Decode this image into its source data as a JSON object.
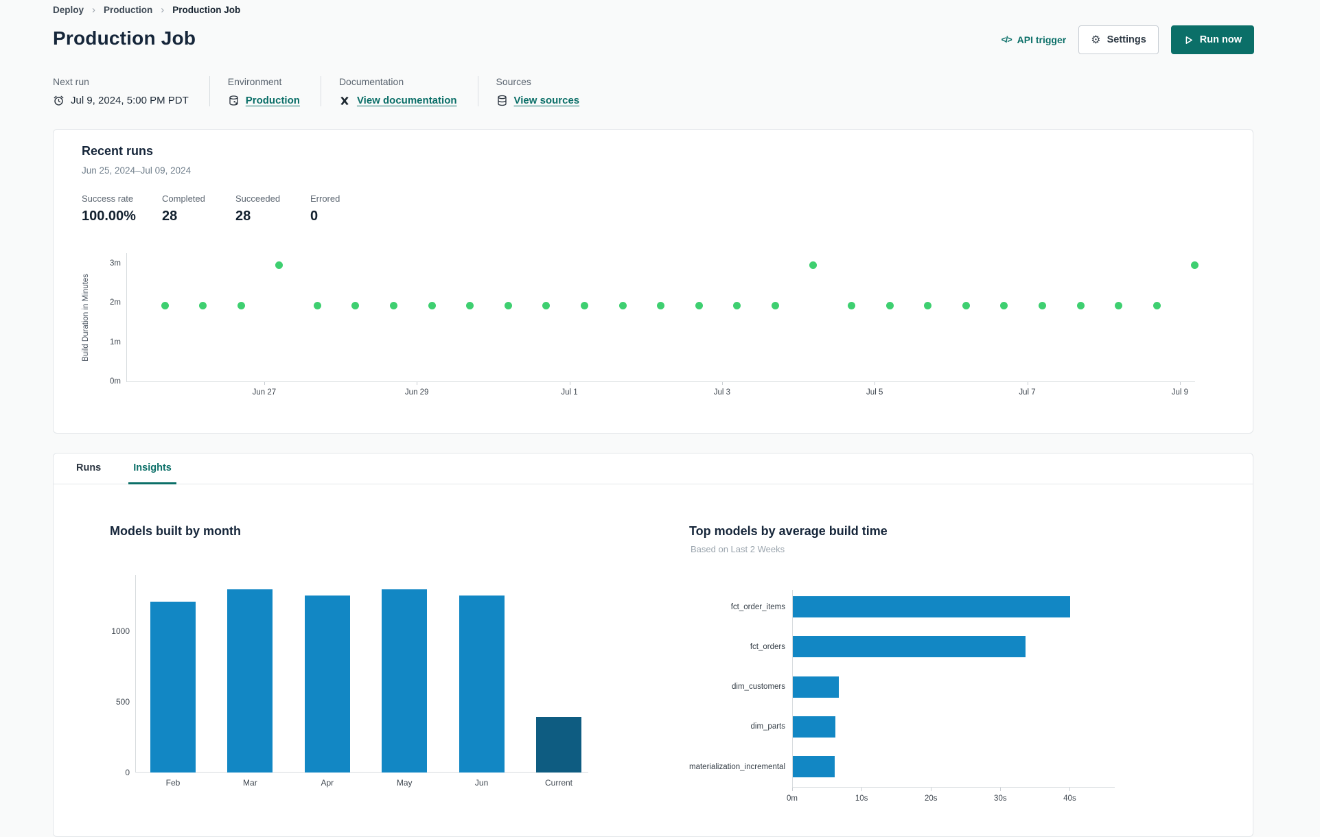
{
  "breadcrumb": {
    "items": [
      "Deploy",
      "Production",
      "Production Job"
    ]
  },
  "header": {
    "title": "Production Job",
    "api_trigger_label": "API trigger",
    "settings_label": "Settings",
    "run_now_label": "Run now"
  },
  "icons": {
    "code_glyph": "</>",
    "gear_glyph": "⚙",
    "chevron_glyph": "›"
  },
  "meta": {
    "next_run": {
      "label": "Next run",
      "value": "Jul 9, 2024, 5:00 PM PDT"
    },
    "environment": {
      "label": "Environment",
      "value": "Production"
    },
    "documentation": {
      "label": "Documentation",
      "value": "View documentation"
    },
    "sources": {
      "label": "Sources",
      "value": "View sources"
    }
  },
  "recent_runs": {
    "title": "Recent runs",
    "date_range": "Jun 25, 2024–Jul 09, 2024",
    "stats": [
      {
        "label": "Success rate",
        "value": "100.00%"
      },
      {
        "label": "Completed",
        "value": "28"
      },
      {
        "label": "Succeeded",
        "value": "28"
      },
      {
        "label": "Errored",
        "value": "0"
      }
    ]
  },
  "tabs": [
    {
      "label": "Runs",
      "active": false
    },
    {
      "label": "Insights",
      "active": true
    }
  ],
  "colors": {
    "teal": "#0b6f68",
    "bar_blue": "#1287c4",
    "bar_dark": "#0e5c81",
    "dot_green": "#3ecf70",
    "card_border": "#e3e6e9",
    "axis": "#d7dbde"
  },
  "chart_data": [
    {
      "id": "build_duration_scatter",
      "type": "scatter",
      "ylabel": "Build Duration in Minutes",
      "ylim": [
        0,
        3.28
      ],
      "yticks": [
        {
          "v": 0,
          "label": "0m"
        },
        {
          "v": 1,
          "label": "1m"
        },
        {
          "v": 2,
          "label": "2m"
        },
        {
          "v": 3,
          "label": "3m"
        }
      ],
      "xticks": [
        {
          "frac": 0.129,
          "label": "Jun 27"
        },
        {
          "frac": 0.2718,
          "label": "Jun 29"
        },
        {
          "frac": 0.4146,
          "label": "Jul 1"
        },
        {
          "frac": 0.5574,
          "label": "Jul 3"
        },
        {
          "frac": 0.7002,
          "label": "Jul 5"
        },
        {
          "frac": 0.843,
          "label": "Jul 7"
        },
        {
          "frac": 0.9858,
          "label": "Jul 9"
        }
      ],
      "x_start_frac": 0.036,
      "x_step_frac": 0.0357,
      "grid": false,
      "points_minutes": [
        1.95,
        1.95,
        1.95,
        2.97,
        1.95,
        1.95,
        1.95,
        1.95,
        1.95,
        1.95,
        1.95,
        1.95,
        1.95,
        1.95,
        1.95,
        1.95,
        1.95,
        2.97,
        1.95,
        1.95,
        1.95,
        1.95,
        1.95,
        1.95,
        1.95,
        1.95,
        1.95,
        2.97
      ],
      "point_color": "#3ecf70"
    },
    {
      "id": "models_built_by_month",
      "type": "bar",
      "title": "Models built by month",
      "categories": [
        "Feb",
        "Mar",
        "Apr",
        "May",
        "Jun",
        "Current"
      ],
      "values": [
        1210,
        1300,
        1255,
        1300,
        1255,
        395
      ],
      "bar_colors": [
        "#1287c4",
        "#1287c4",
        "#1287c4",
        "#1287c4",
        "#1287c4",
        "#0e5c81"
      ],
      "yticks": [
        {
          "v": 0,
          "label": "0"
        },
        {
          "v": 500,
          "label": "500"
        },
        {
          "v": 1000,
          "label": "1000"
        }
      ],
      "ylim": [
        0,
        1400
      ],
      "grid": false
    },
    {
      "id": "top_models_by_avg_build_time",
      "type": "bar_horizontal",
      "title": "Top models by average build time",
      "subtitle": "Based on Last 2 Weeks",
      "categories": [
        "fct_order_items",
        "fct_orders",
        "dim_customers",
        "dim_parts",
        "materialization_incremental"
      ],
      "values_seconds": [
        40,
        33.5,
        6.6,
        6.1,
        6.0
      ],
      "xticks": [
        {
          "v": 0,
          "label": "0m"
        },
        {
          "v": 10,
          "label": "10s"
        },
        {
          "v": 20,
          "label": "20s"
        },
        {
          "v": 30,
          "label": "30s"
        },
        {
          "v": 40,
          "label": "40s"
        }
      ],
      "xlim": [
        0,
        45
      ],
      "bar_color": "#1287c4",
      "grid": false
    }
  ]
}
